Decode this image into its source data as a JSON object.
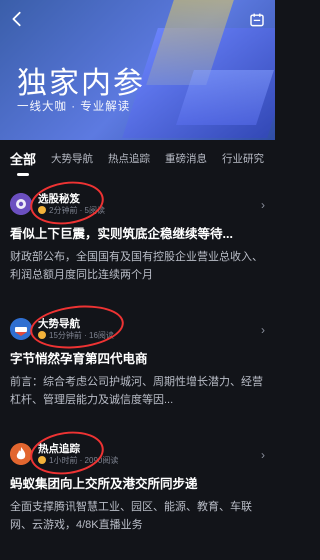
{
  "hero": {
    "title": "独家内参",
    "subtitle": "一线大咖 · 专业解读"
  },
  "tabs": [
    {
      "label": "全部"
    },
    {
      "label": "大势导航"
    },
    {
      "label": "热点追踪"
    },
    {
      "label": "重磅消息"
    },
    {
      "label": "行业研究"
    }
  ],
  "cards": [
    {
      "source": "选股秘笈",
      "info": "2分钟前 · 5阅读",
      "headline": "看似上下巨震，实则筑底企稳继续等待...",
      "summary": "财政部公布，全国国有及国有控股企业营业总收入、利润总额月度同比连续两个月"
    },
    {
      "source": "大势导航",
      "info": "15分钟前 · 16阅读",
      "headline": "字节悄然孕育第四代电商",
      "summary": "前言：综合考虑公司护城河、周期性增长潜力、经营杠杆、管理层能力及诚信度等因..."
    },
    {
      "source": "热点追踪",
      "info": "1小时前 · 2090阅读",
      "headline": "蚂蚁集团向上交所及港交所同步递",
      "summary": "全面支撑腾讯智慧工业、园区、能源、教育、车联网、云游戏，4/8K直播业务"
    }
  ],
  "colors": {
    "background": "#121419",
    "hero_accent": "#5d7ae1",
    "annotation": "#e33333"
  }
}
